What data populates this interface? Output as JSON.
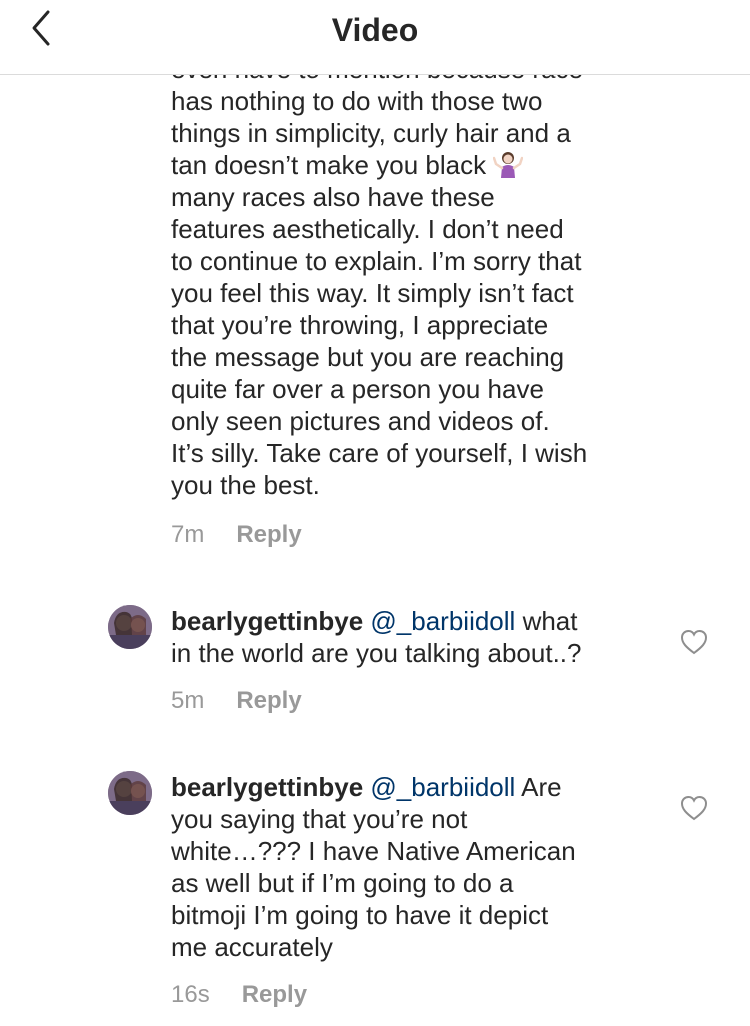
{
  "header": {
    "title": "Video",
    "back_icon": "chevron-left-icon"
  },
  "comments": [
    {
      "text_lines": [
        "even have to mention because race",
        "has nothing to do with those two",
        "things in simplicity, curly hair and a",
        "tan doesn’t make you black",
        "many races also have these",
        "features aesthetically. I don’t need",
        "to continue to explain. I’m sorry that",
        "you feel this way. It simply isn’t fact",
        "that you’re throwing, I appreciate",
        "the message but you are reaching",
        "quite far over a person you have",
        "only seen pictures and videos of.",
        "It’s silly. Take care of yourself, I wish",
        "you the best."
      ],
      "emoji": "person-shrugging-emoji",
      "time": "7m",
      "reply_label": "Reply"
    },
    {
      "username": "bearlygettinbye",
      "mention": "@_barbiidoll",
      "text_first": "what",
      "text_lines": [
        "in the world are you talking about..?"
      ],
      "time": "5m",
      "reply_label": "Reply",
      "like_icon": "heart-outline-icon"
    },
    {
      "username": "bearlygettinbye",
      "mention": "@_barbiidoll",
      "text_first": "Are",
      "text_lines": [
        "you saying that you’re not",
        "white…??? I have Native American",
        "as well but if I’m going to do a",
        "bitmoji I’m going to have it depict",
        "me accurately"
      ],
      "time": "16s",
      "reply_label": "Reply",
      "like_icon": "heart-outline-icon"
    }
  ]
}
